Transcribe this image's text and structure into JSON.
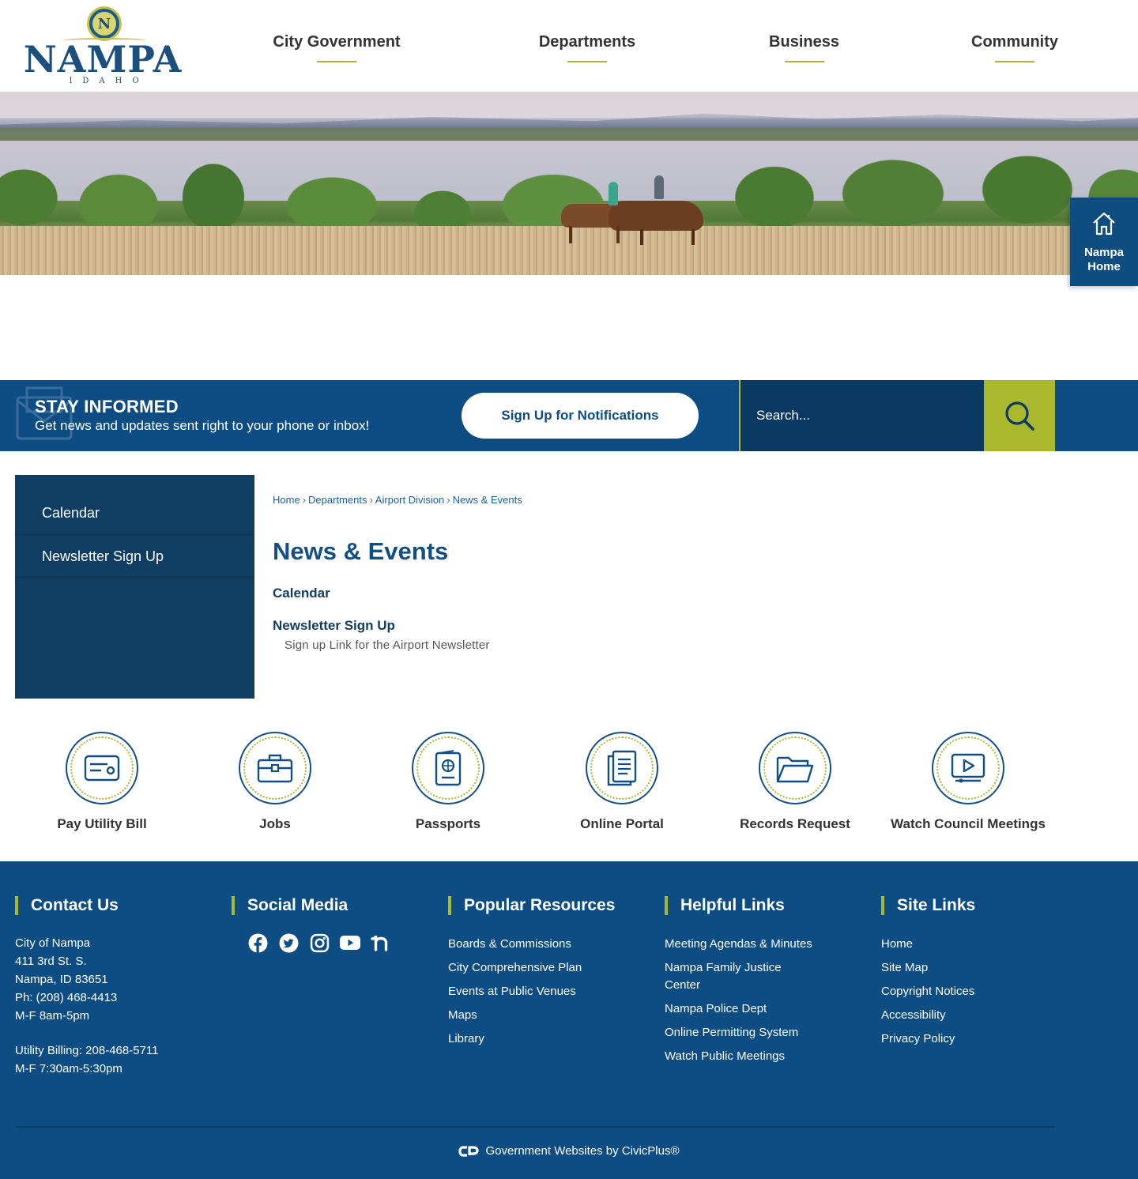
{
  "logo": {
    "text": "NAMPA",
    "state": "IDAHO",
    "seal_letter": "N"
  },
  "nav": [
    {
      "label": "City Government"
    },
    {
      "label": "Departments"
    },
    {
      "label": "Business"
    },
    {
      "label": "Community"
    }
  ],
  "home_tab": {
    "line1": "Nampa",
    "line2": "Home",
    "icon": "house-icon"
  },
  "stay_informed": {
    "title": "STAY INFORMED",
    "subtitle": "Get news and updates sent right to your phone or inbox!",
    "button_label": "Sign Up for Notifications",
    "icon": "envelope-icon"
  },
  "search": {
    "placeholder": "Search...",
    "icon": "search-icon"
  },
  "sidebar": {
    "items": [
      {
        "label": "Calendar"
      },
      {
        "label": "Newsletter Sign Up"
      }
    ]
  },
  "breadcrumb": [
    {
      "label": "Home"
    },
    {
      "label": "Departments"
    },
    {
      "label": "Airport Division"
    },
    {
      "label": "News & Events"
    }
  ],
  "breadcrumb_sep": "›",
  "page": {
    "title": "News & Events",
    "links": [
      {
        "label": "Calendar",
        "description": ""
      },
      {
        "label": "Newsletter Sign Up",
        "description": "Sign up Link for the Airport Newsletter"
      }
    ]
  },
  "quick_links": [
    {
      "label": "Pay Utility Bill",
      "icon": "utility-bill-icon"
    },
    {
      "label": "Jobs",
      "icon": "briefcase-icon"
    },
    {
      "label": "Passports",
      "icon": "passport-icon"
    },
    {
      "label": "Online Portal",
      "icon": "document-icon"
    },
    {
      "label": "Records Request",
      "icon": "folder-icon"
    },
    {
      "label": "Watch Council Meetings",
      "icon": "video-icon"
    }
  ],
  "footer": {
    "contact": {
      "heading": "Contact Us",
      "lines": [
        "City of Nampa",
        "411 3rd St. S.",
        "Nampa, ID 83651",
        "Ph: (208) 468-4413",
        "M-F 8am-5pm"
      ],
      "billing_lines": [
        "Utility Billing: 208-468-5711",
        "M-F 7:30am-5:30pm"
      ]
    },
    "social": {
      "heading": "Social Media",
      "icons": [
        "facebook-icon",
        "twitter-icon",
        "instagram-icon",
        "youtube-icon",
        "nextdoor-icon"
      ]
    },
    "popular": {
      "heading": "Popular Resources",
      "links": [
        "Boards & Commissions",
        "City Comprehensive Plan",
        "Events at Public Venues",
        "Maps",
        "Library"
      ]
    },
    "helpful": {
      "heading": "Helpful Links",
      "links": [
        "Meeting Agendas & Minutes",
        "Nampa Family Justice Center",
        "Nampa Police Dept",
        "Online Permitting System",
        "Watch Public Meetings"
      ]
    },
    "site": {
      "heading": "Site Links",
      "links": [
        "Home",
        "Site Map",
        "Copyright Notices",
        "Accessibility",
        "Privacy Policy"
      ]
    },
    "credit": "Government Websites by CivicPlus®"
  },
  "colors": {
    "navy": "#0d4d84",
    "lime": "#a9b82d",
    "dark_navy": "#103d62"
  }
}
